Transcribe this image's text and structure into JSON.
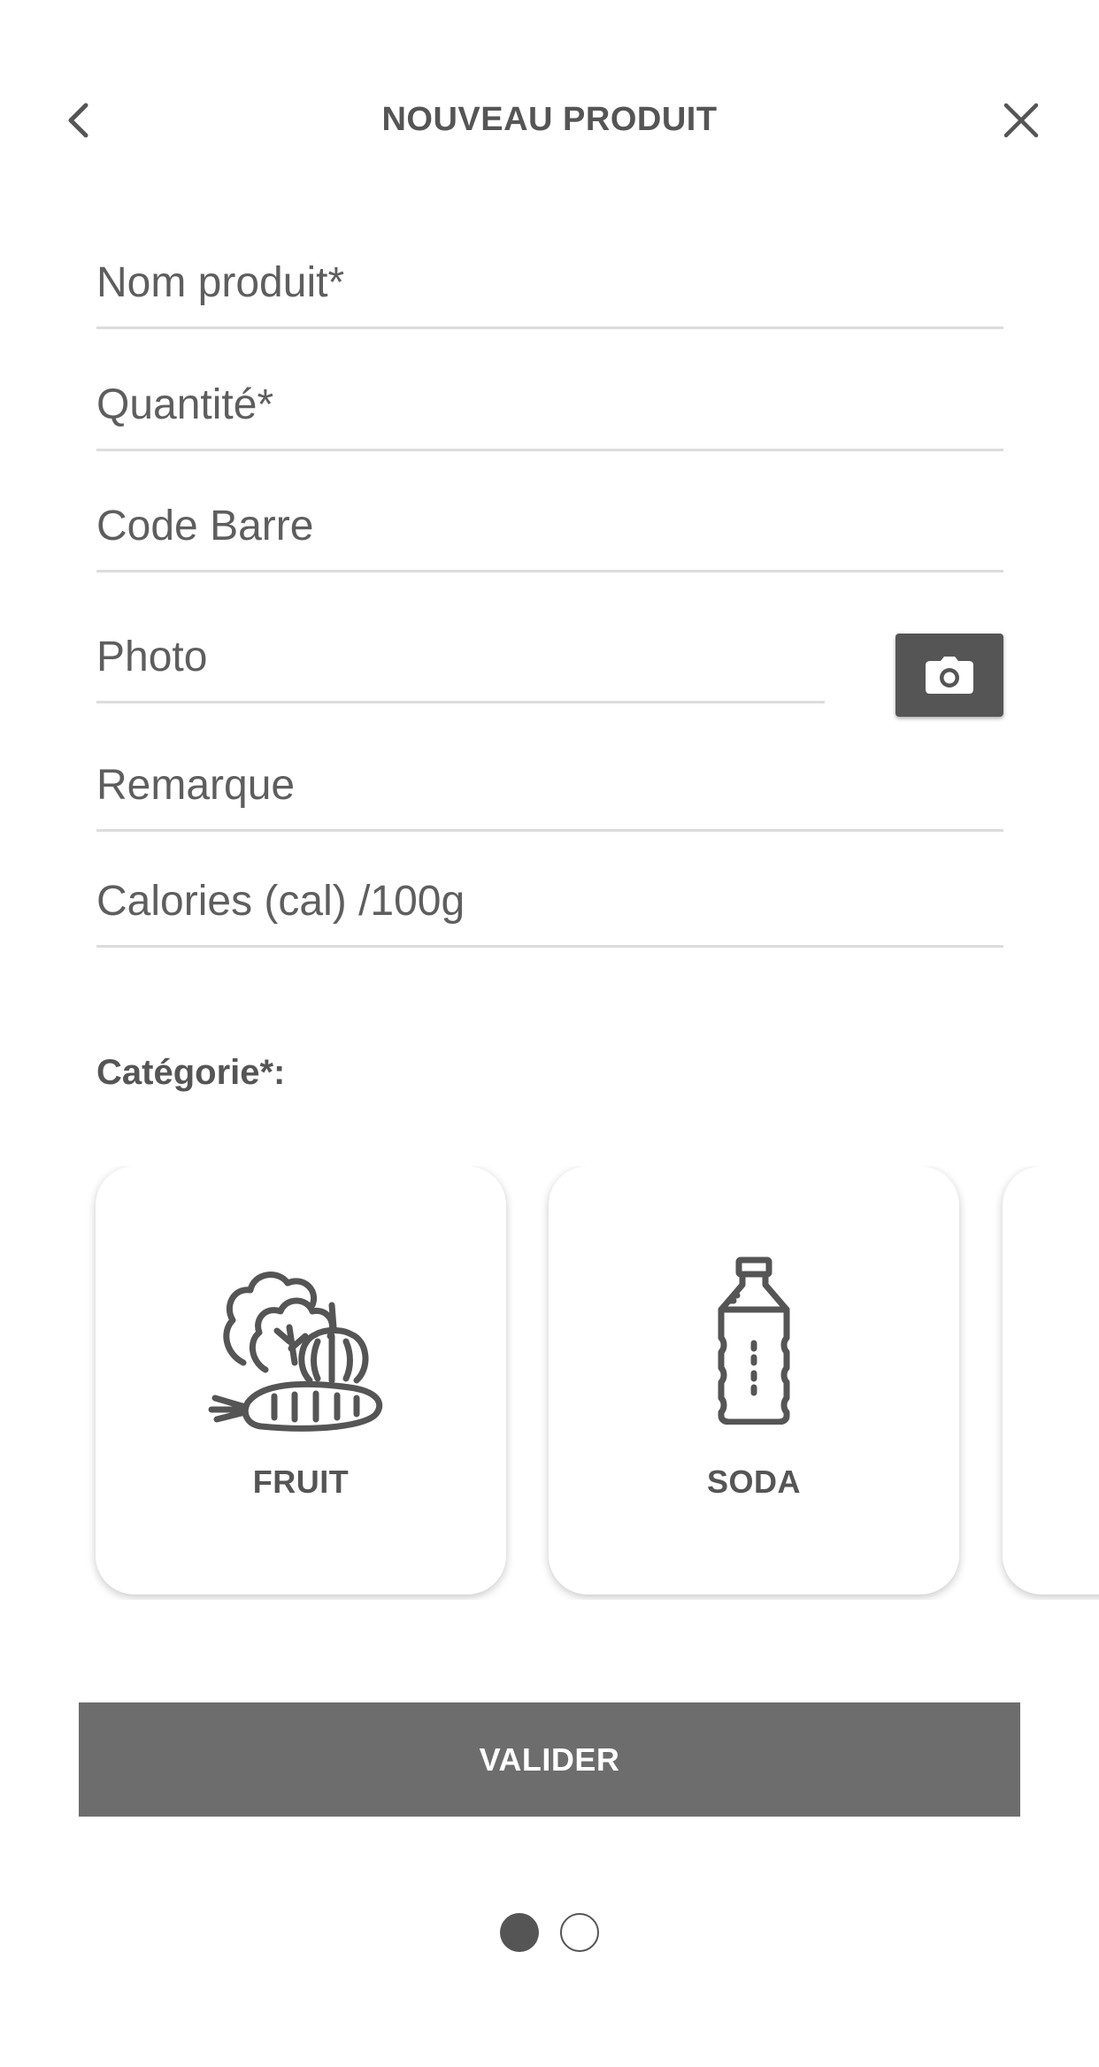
{
  "header": {
    "title": "NOUVEAU PRODUIT",
    "back_icon": "chevron-left-icon",
    "close_icon": "close-icon"
  },
  "form": {
    "name_placeholder": "Nom produit*",
    "quantity_placeholder": "Quantité*",
    "barcode_placeholder": "Code Barre",
    "photo_placeholder": "Photo",
    "remark_placeholder": "Remarque",
    "calories_placeholder": "Calories (cal) /100g",
    "camera_icon": "camera-icon"
  },
  "category": {
    "label": "Catégorie*:",
    "items": [
      {
        "label": "FRUIT",
        "icon": "vegetables-icon"
      },
      {
        "label": "SODA",
        "icon": "bottle-icon"
      }
    ]
  },
  "actions": {
    "validate_label": "VALIDER"
  },
  "pager": {
    "current": 1,
    "total": 2
  },
  "colors": {
    "text": "#555555",
    "button": "#6d6d6d",
    "divider": "#dcdcdc"
  }
}
